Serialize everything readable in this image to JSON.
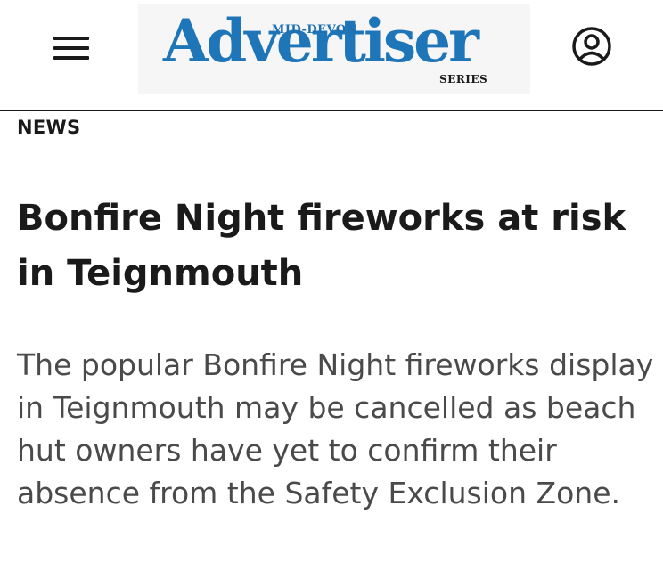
{
  "header": {
    "menu_icon": "hamburger-menu-icon",
    "account_icon": "user-account-icon",
    "logo": {
      "top_text": "MID-DEVON",
      "main_text": "Advertiser",
      "bottom_text": "SERIES",
      "color": "#1e75b8"
    }
  },
  "article": {
    "section": "NEWS",
    "headline": "Bonfire Night fireworks at risk in Teignmouth",
    "standfirst": "The popular Bonfire Night fireworks display in Teignmouth may be cancelled as beach hut owners have yet to confirm their absence from the Safety Exclusion Zone."
  }
}
